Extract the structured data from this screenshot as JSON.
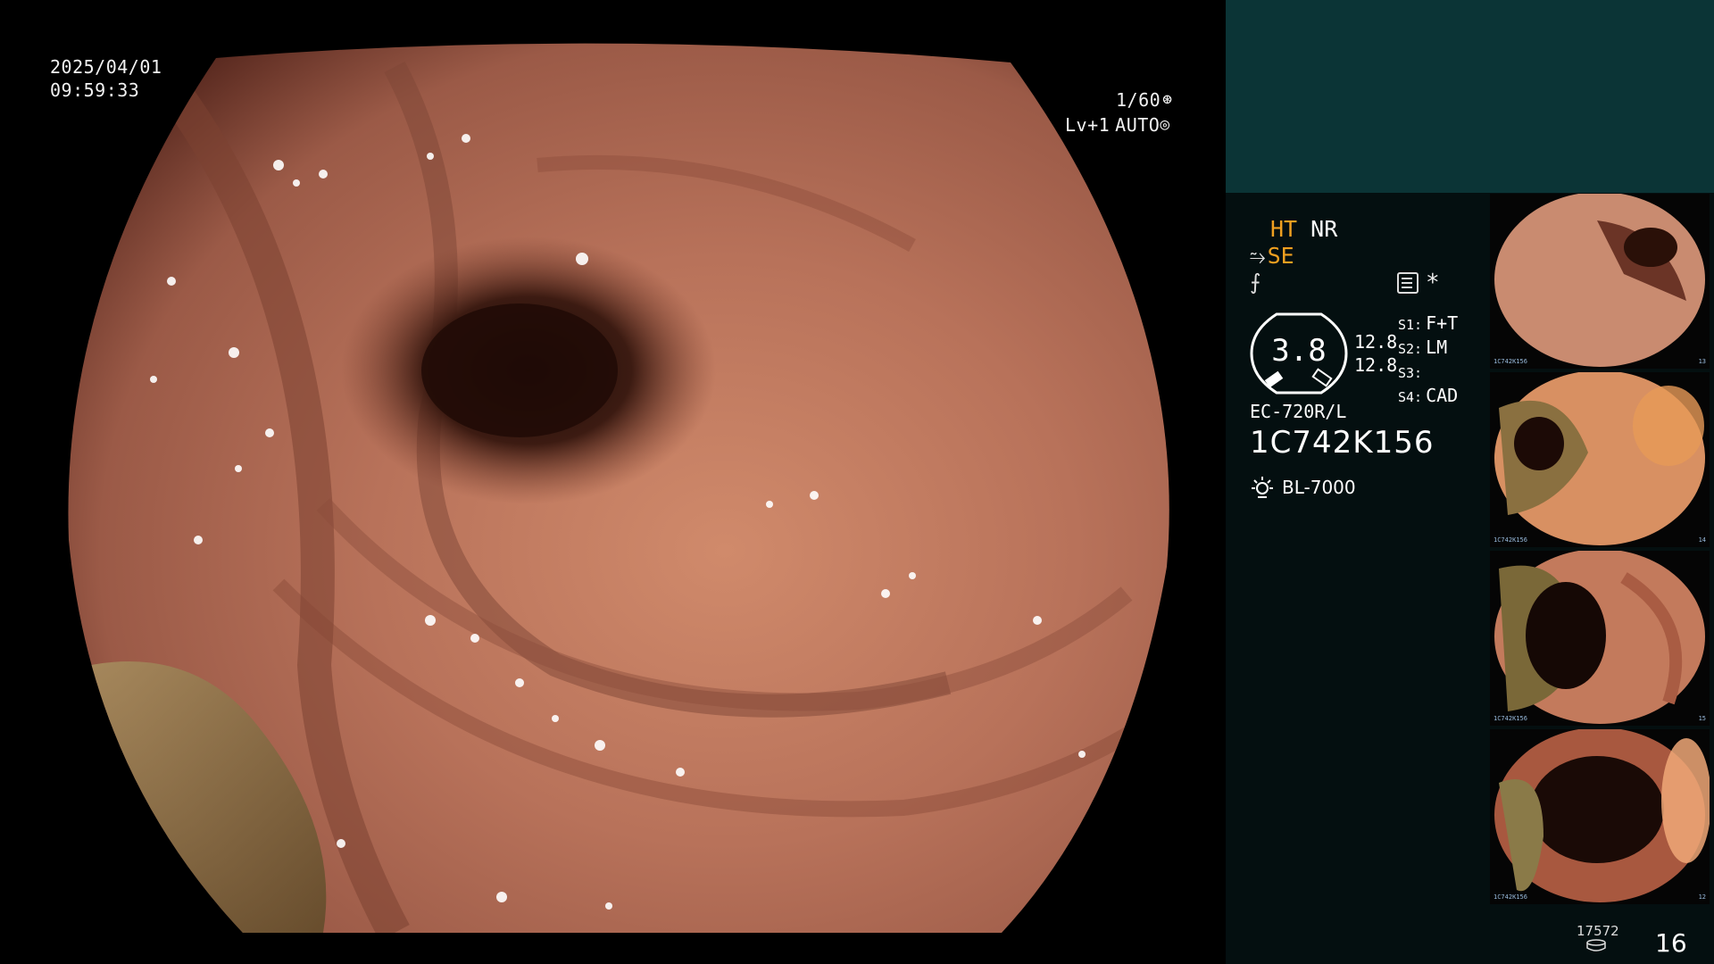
{
  "overlay": {
    "date": "2025/04/01",
    "time": "09:59:33",
    "shutter": "1/60",
    "level": "Lv+1",
    "mode": "AUTO"
  },
  "settings": {
    "ht": "HT",
    "nr": "NR",
    "se": "SE",
    "asterisk": "*"
  },
  "gauge": {
    "value": "3.8",
    "side_top": "12.8",
    "side_bottom": "12.8"
  },
  "s_functions": [
    {
      "label": "S1:",
      "value": "F+T"
    },
    {
      "label": "S2:",
      "value": "LM"
    },
    {
      "label": "S3:",
      "value": ""
    },
    {
      "label": "S4:",
      "value": "CAD"
    }
  ],
  "scope": {
    "model": "EC-720R/L",
    "serial": "1C742K156"
  },
  "light_source": "BL-7000",
  "thumbnails": [
    {
      "serial": "1C742K156",
      "num": "13"
    },
    {
      "serial": "1C742K156",
      "num": "14"
    },
    {
      "serial": "1C742K156",
      "num": "15"
    },
    {
      "serial": "1C742K156",
      "num": "12"
    }
  ],
  "counter": {
    "remaining": "17572",
    "count": "16"
  },
  "icons": {
    "shutter": "shutter-icon",
    "auto": "auto-iris-icon",
    "light": "lamp-icon",
    "storage": "storage-icon",
    "settings": "menu-icon",
    "structure": "structure-enhancement-icon",
    "edge": "edge-enhancement-icon"
  }
}
